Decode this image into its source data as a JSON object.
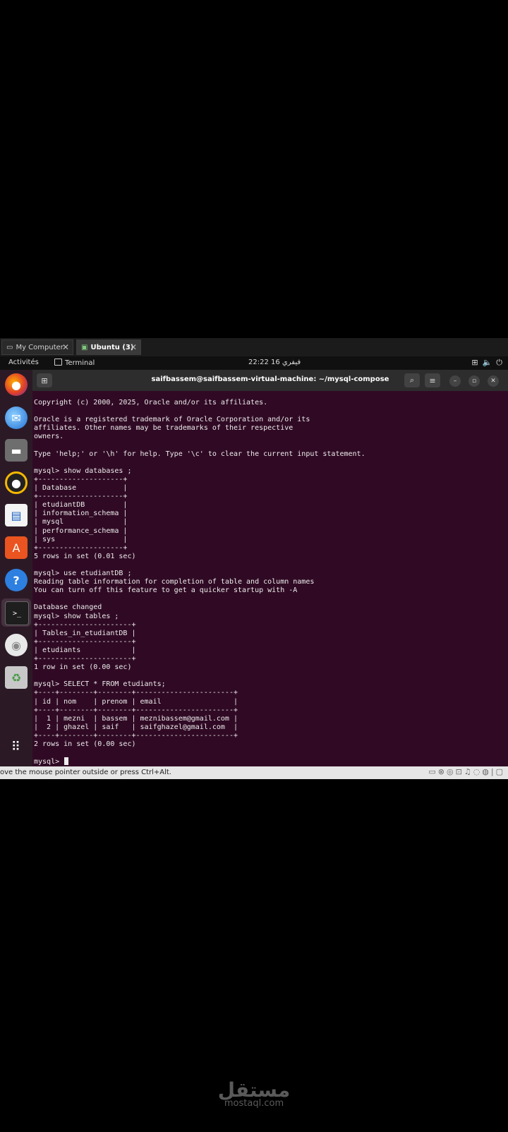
{
  "vm_tabs": [
    {
      "label": "My Computer",
      "icon": "monitor-icon"
    },
    {
      "label": "Ubuntu (3)",
      "icon": "vm-icon"
    }
  ],
  "topbar": {
    "activities": "Activités",
    "app_name": "Terminal",
    "clock": "22:22  فيفري 16"
  },
  "dock": {
    "items": [
      "firefox",
      "thunderbird",
      "files",
      "rhythmbox",
      "writer",
      "app-center",
      "help",
      "terminal",
      "disc",
      "trash",
      "app-grid"
    ]
  },
  "terminal": {
    "title": "saifbassem@saifbassem-virtual-machine: ~/mysql-compose",
    "lines": [
      "Copyright (c) 2000, 2025, Oracle and/or its affiliates.",
      "",
      "Oracle is a registered trademark of Oracle Corporation and/or its",
      "affiliates. Other names may be trademarks of their respective",
      "owners.",
      "",
      "Type 'help;' or '\\h' for help. Type '\\c' to clear the current input statement.",
      "",
      "mysql> show databases ;",
      "+--------------------+",
      "| Database           |",
      "+--------------------+",
      "| etudiantDB         |",
      "| information_schema |",
      "| mysql              |",
      "| performance_schema |",
      "| sys                |",
      "+--------------------+",
      "5 rows in set (0.01 sec)",
      "",
      "mysql> use etudiantDB ;",
      "Reading table information for completion of table and column names",
      "You can turn off this feature to get a quicker startup with -A",
      "",
      "Database changed",
      "mysql> show tables ;",
      "+----------------------+",
      "| Tables_in_etudiantDB |",
      "+----------------------+",
      "| etudiants            |",
      "+----------------------+",
      "1 row in set (0.00 sec)",
      "",
      "mysql> SELECT * FROM etudiants;",
      "+----+--------+--------+-----------------------+",
      "| id | nom    | prenom | email                 |",
      "+----+--------+--------+-----------------------+",
      "|  1 | mezni  | bassem | meznibassem@gmail.com |",
      "|  2 | ghazel | saif   | saifghazel@gmail.com  |",
      "+----+--------+--------+-----------------------+",
      "2 rows in set (0.00 sec)",
      "",
      "mysql> "
    ]
  },
  "statusbar": {
    "message": "ove the mouse pointer outside or press Ctrl+Alt."
  },
  "watermark": {
    "arabic": "مستقل",
    "latin": "mostaql.com"
  }
}
